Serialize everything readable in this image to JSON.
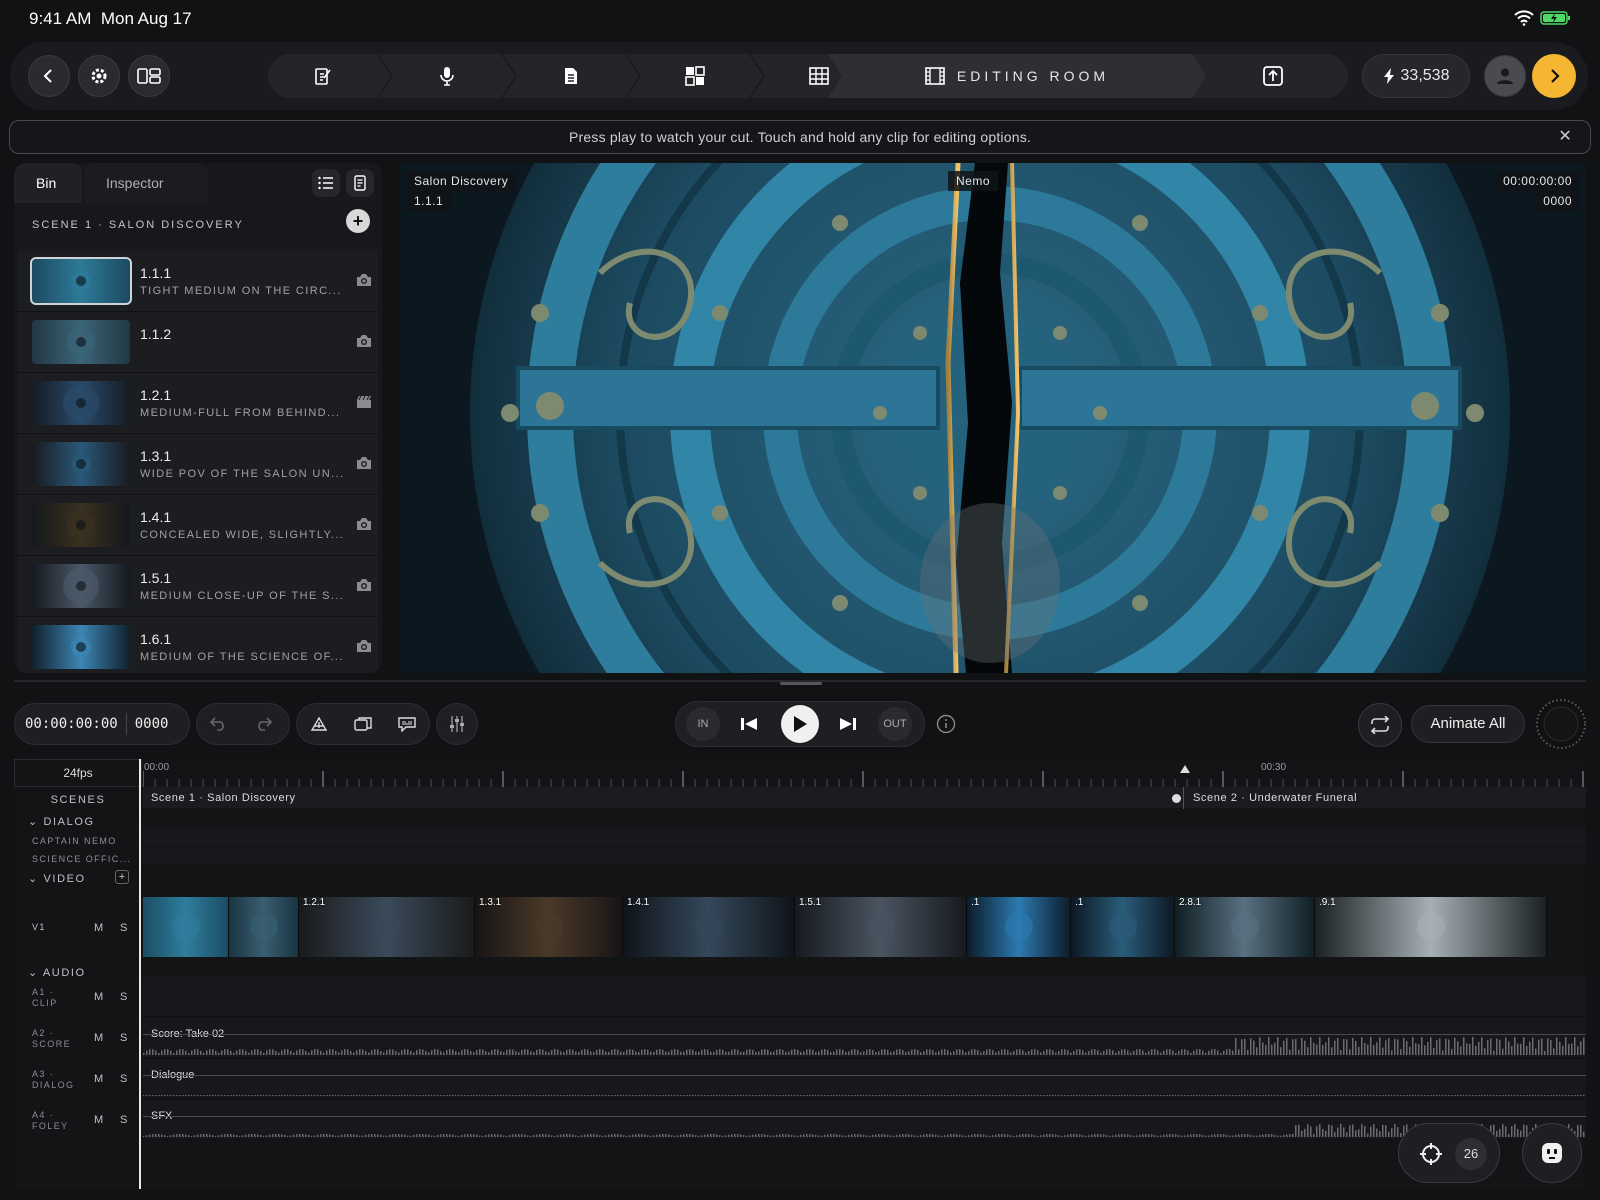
{
  "status": {
    "time": "9:41 AM",
    "date": "Mon Aug 17"
  },
  "topbar": {
    "steps": [
      "script-icon",
      "microphone-icon",
      "document-icon",
      "storyboard-icon",
      "grid-icon",
      "film-icon",
      "export-icon"
    ],
    "active_step_label": "EDITING ROOM",
    "credits": "33,538",
    "accent": "#f5b731"
  },
  "banner": {
    "text": "Press play to watch your cut. Touch and hold any clip for editing options."
  },
  "bin": {
    "tabs": [
      "Bin",
      "Inspector"
    ],
    "scene_header": "SCENE 1 · SALON DISCOVERY",
    "shots": [
      {
        "num": "1.1.1",
        "desc": "TIGHT MEDIUM ON THE CIRC...",
        "icon": "camera-icon"
      },
      {
        "num": "1.1.2",
        "desc": "",
        "icon": "camera-icon"
      },
      {
        "num": "1.2.1",
        "desc": "MEDIUM-FULL FROM BEHIND...",
        "icon": "clapperboard-icon"
      },
      {
        "num": "1.3.1",
        "desc": "WIDE POV OF THE SALON UN...",
        "icon": "camera-icon"
      },
      {
        "num": "1.4.1",
        "desc": "CONCEALED WIDE, SLIGHTLY...",
        "icon": "camera-icon"
      },
      {
        "num": "1.5.1",
        "desc": "MEDIUM CLOSE-UP OF THE S...",
        "icon": "camera-icon"
      },
      {
        "num": "1.6.1",
        "desc": "MEDIUM OF THE SCIENCE OF...",
        "icon": "camera-icon"
      }
    ]
  },
  "viewer": {
    "scene": "Salon Discovery",
    "shot": "1.1.1",
    "character": "Nemo",
    "timecode": "00:00:00:00",
    "frame": "0000"
  },
  "controls": {
    "timecode": "00:00:00:00",
    "frame": "0000",
    "in": "IN",
    "out": "OUT",
    "animate_all": "Animate All"
  },
  "timeline": {
    "fps": "24fps",
    "ruler": [
      "00:00",
      "00:30"
    ],
    "scenes_label": "SCENES",
    "scenes": [
      "Scene 1 · Salon Discovery",
      "Scene 2 · Underwater Funeral"
    ],
    "dialog_label": "DIALOG",
    "dialog_tracks": [
      "CAPTAIN NEMO",
      "SCIENCE OFFIC..."
    ],
    "video_label": "VIDEO",
    "v1": "V1",
    "clips": [
      "",
      "",
      "1.2.1",
      "1.3.1",
      "1.4.1",
      "1.5.1",
      ".1",
      ".1",
      "2.8.1",
      ".9.1"
    ],
    "audio_label": "AUDIO",
    "audio_tracks": [
      {
        "name": "A1 · CLIP",
        "clip": ""
      },
      {
        "name": "A2 · SCORE",
        "clip": "Score: Take 02"
      },
      {
        "name": "A3 · DIALOG",
        "clip": "Dialogue"
      },
      {
        "name": "A4 · FOLEY",
        "clip": "SFX"
      }
    ],
    "m": "M",
    "s": "S",
    "target_count": "26"
  }
}
